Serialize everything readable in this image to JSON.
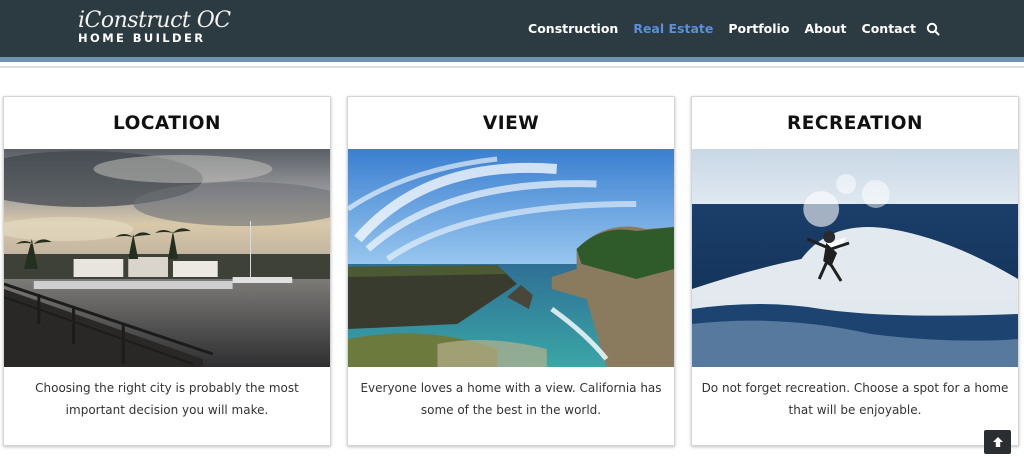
{
  "brand": {
    "script": "iConstruct OC",
    "subtitle": "HOME BUILDER"
  },
  "nav": {
    "items": [
      {
        "label": "Construction",
        "active": false
      },
      {
        "label": "Real Estate",
        "active": true
      },
      {
        "label": "Portfolio",
        "active": false
      },
      {
        "label": "About",
        "active": false
      },
      {
        "label": "Contact",
        "active": false
      }
    ],
    "search_icon": "search-icon"
  },
  "cards": [
    {
      "title": "LOCATION",
      "image": "harbor-marina-photo",
      "text": "Choosing the right city is probably the most important decision you will make."
    },
    {
      "title": "VIEW",
      "image": "coastal-cove-photo",
      "text": "Everyone loves a home with a view. California has some of the best in the world."
    },
    {
      "title": "RECREATION",
      "image": "surfer-wave-photo",
      "text": "Do not forget recreation. Choose a spot for a home that will be enjoyable."
    }
  ],
  "back_to_top": {
    "icon": "arrow-up-icon"
  },
  "colors": {
    "header_bg": "#2c3a41",
    "accent_stripe": "#6f93ae",
    "nav_active": "#5b8fd8",
    "nav_text": "#ffffff"
  }
}
